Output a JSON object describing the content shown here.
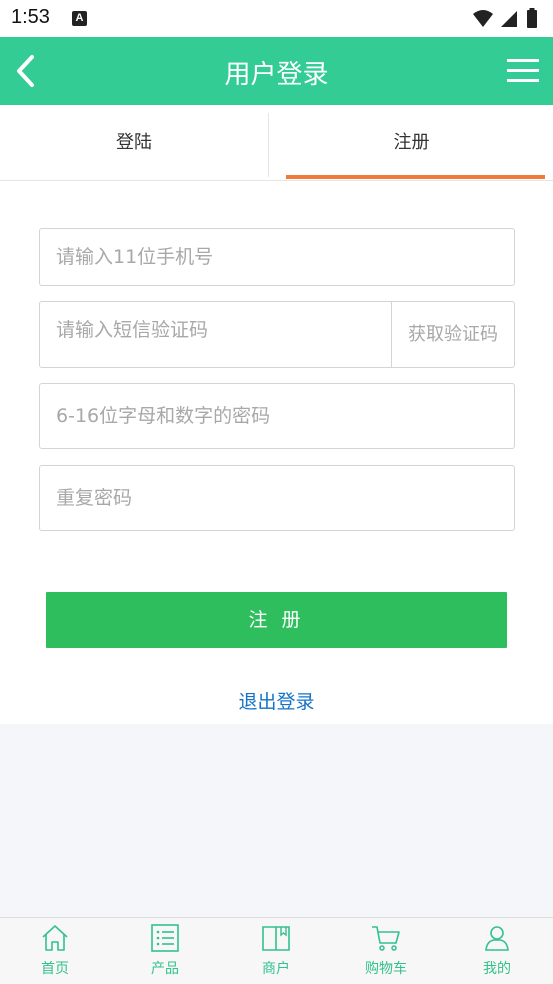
{
  "status_bar": {
    "time": "1:53",
    "notification_letter": "A"
  },
  "app_bar": {
    "title": "用户登录"
  },
  "tabs": [
    {
      "label": "登陆",
      "active": false
    },
    {
      "label": "注册",
      "active": true
    }
  ],
  "form": {
    "phone_placeholder": "请输入11位手机号",
    "sms_placeholder": "请输入短信验证码",
    "sms_button": "获取验证码",
    "password_placeholder": "6-16位字母和数字的密码",
    "confirm_placeholder": "重复密码",
    "submit_label": "注 册",
    "logout_label": "退出登录"
  },
  "bottom_nav": [
    {
      "label": "首页",
      "icon": "home-icon"
    },
    {
      "label": "产品",
      "icon": "list-icon"
    },
    {
      "label": "商户",
      "icon": "book-icon"
    },
    {
      "label": "购物车",
      "icon": "cart-icon"
    },
    {
      "label": "我的",
      "icon": "user-icon"
    }
  ],
  "colors": {
    "brand": "#33cc95",
    "tab_accent": "#f07a3a",
    "submit": "#2fbe5e",
    "link": "#1473c8"
  }
}
